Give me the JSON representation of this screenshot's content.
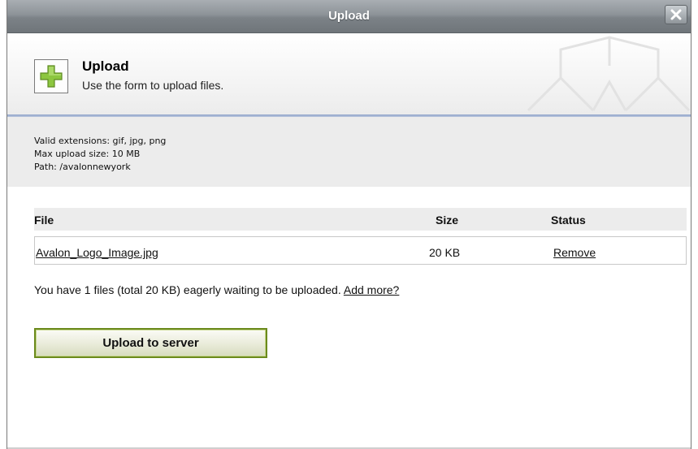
{
  "window": {
    "title": "Upload"
  },
  "header": {
    "title": "Upload",
    "subtitle": "Use the form to upload files.",
    "icon": "plus-icon"
  },
  "info": {
    "lines": [
      "Valid extensions: gif, jpg, png",
      "Max upload size: 10 MB",
      "Path: /avalonnewyork"
    ]
  },
  "table": {
    "columns": [
      "File",
      "Size",
      "Status"
    ],
    "rows": [
      {
        "file": "Avalon_Logo_Image.jpg",
        "size": "20 KB",
        "status": "Remove"
      }
    ]
  },
  "summary": {
    "text": "You have 1 files (total 20 KB) eagerly waiting to be uploaded.",
    "link": "Add more?"
  },
  "actions": {
    "upload_label": "Upload to server"
  },
  "colors": {
    "titlebar": "#8d9398",
    "accent_line": "#8ea2c8",
    "button_border": "#6b8a1c",
    "plus_green": "#8cc63f"
  }
}
